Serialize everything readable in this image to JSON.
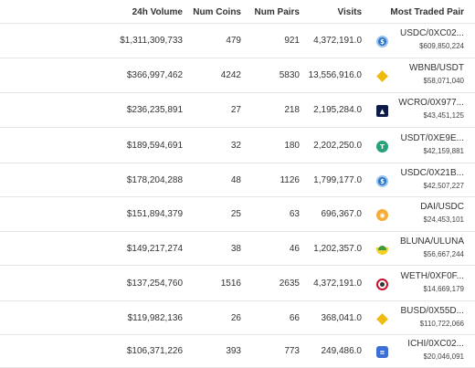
{
  "table": {
    "headers": {
      "volume": "24h Volume",
      "coins": "Num Coins",
      "pairs": "Num Pairs",
      "visits": "Visits",
      "pair": "Most Traded Pair"
    },
    "rows": [
      {
        "volume": "$1,311,309,733",
        "coins": "479",
        "pairs": "921",
        "visits": "4,372,191.0",
        "pair": "USDC/0XC02...",
        "pair_volume": "$609,850,224",
        "icon": "usdc-icon",
        "icon_color": "#2775ca"
      },
      {
        "volume": "$366,997,462",
        "coins": "4242",
        "pairs": "5830",
        "visits": "13,556,916.0",
        "pair": "WBNB/USDT",
        "pair_volume": "$58,071,040",
        "icon": "bnb-icon",
        "icon_color": "#f0b90b"
      },
      {
        "volume": "$236,235,891",
        "coins": "27",
        "pairs": "218",
        "visits": "2,195,284.0",
        "pair": "WCRO/0X977...",
        "pair_volume": "$43,451,125",
        "icon": "cro-icon",
        "icon_color": "#0d1b48"
      },
      {
        "volume": "$189,594,691",
        "coins": "32",
        "pairs": "180",
        "visits": "2,202,250.0",
        "pair": "USDT/0XE9E...",
        "pair_volume": "$42,159,881",
        "icon": "usdt-icon",
        "icon_color": "#26a17b"
      },
      {
        "volume": "$178,204,288",
        "coins": "48",
        "pairs": "1126",
        "visits": "1,799,177.0",
        "pair": "USDC/0X21B...",
        "pair_volume": "$42,507,227",
        "icon": "usdc-icon",
        "icon_color": "#2775ca"
      },
      {
        "volume": "$151,894,379",
        "coins": "25",
        "pairs": "63",
        "visits": "696,367.0",
        "pair": "DAI/USDC",
        "pair_volume": "$24,453,101",
        "icon": "dai-icon",
        "icon_color": "#f5ac37"
      },
      {
        "volume": "$149,217,274",
        "coins": "38",
        "pairs": "46",
        "visits": "1,202,357.0",
        "pair": "BLUNA/ULUNA",
        "pair_volume": "$56,667,244",
        "icon": "luna-icon",
        "icon_color": "#f6cf28"
      },
      {
        "volume": "$137,254,760",
        "coins": "1516",
        "pairs": "2635",
        "visits": "4,372,191.0",
        "pair": "WETH/0XF0F...",
        "pair_volume": "$14,669,179",
        "icon": "weth-icon",
        "icon_color": "#c8102e"
      },
      {
        "volume": "$119,982,136",
        "coins": "26",
        "pairs": "66",
        "visits": "368,041.0",
        "pair": "BUSD/0X55D...",
        "pair_volume": "$110,722,066",
        "icon": "busd-icon",
        "icon_color": "#f0b90b"
      },
      {
        "volume": "$106,371,226",
        "coins": "393",
        "pairs": "773",
        "visits": "249,486.0",
        "pair": "ICHI/0XC02...",
        "pair_volume": "$20,046,091",
        "icon": "ichi-icon",
        "icon_color": "#3a6fd8"
      }
    ]
  }
}
